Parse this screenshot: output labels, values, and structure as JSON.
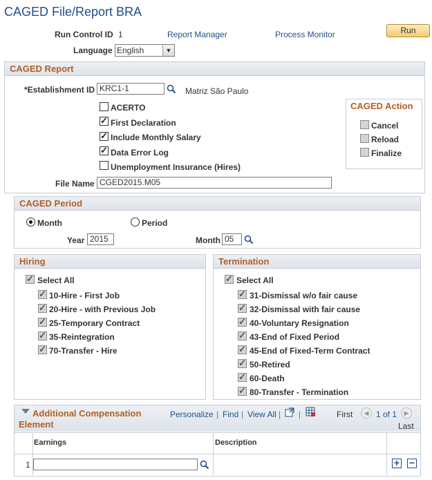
{
  "page": {
    "title": "CAGED File/Report BRA"
  },
  "header": {
    "run_control_label": "Run Control ID",
    "run_control_value": "1",
    "report_manager": "Report Manager",
    "process_monitor": "Process Monitor",
    "run_button": "Run",
    "language_label": "Language",
    "language_value": "English"
  },
  "report": {
    "title": "CAGED Report",
    "establishment_label": "*Establishment ID",
    "establishment_value": "KRC1-1",
    "establishment_desc": "Matriz São Paulo",
    "options": [
      {
        "label": "ACERTO",
        "checked": false
      },
      {
        "label": "First Declaration",
        "checked": true
      },
      {
        "label": "Include Monthly Salary",
        "checked": true
      },
      {
        "label": "Data Error Log",
        "checked": true
      },
      {
        "label": "Unemployment Insurance (Hires)",
        "checked": false
      }
    ],
    "file_name_label": "File Name",
    "file_name_value": "CGED2015.M05"
  },
  "action": {
    "title": "CAGED Action",
    "items": [
      {
        "label": "Cancel",
        "checked": false
      },
      {
        "label": "Reload",
        "checked": false
      },
      {
        "label": "Finalize",
        "checked": false
      }
    ]
  },
  "period": {
    "title": "CAGED Period",
    "month_radio": "Month",
    "period_radio": "Period",
    "selected": "Month",
    "year_label": "Year",
    "year_value": "2015",
    "month_label": "Month",
    "month_value": "05"
  },
  "hiring": {
    "title": "Hiring",
    "select_all": "Select All",
    "items": [
      "10-Hire - First Job",
      "20-Hire - with Previous Job",
      "25-Temporary Contract",
      "35-Reintegration",
      "70-Transfer - Hire"
    ]
  },
  "termination": {
    "title": "Termination",
    "select_all": "Select All",
    "items": [
      "31-Dismissal w/o fair cause",
      "32-Dismissal with fair cause",
      "40-Voluntary Resignation",
      "43-End of Fixed Period",
      "45-End of Fixed-Term Contract",
      "50-Retired",
      "60-Death",
      "80-Transfer - Termination"
    ]
  },
  "compensation": {
    "title_line1": "Additional Compensation",
    "title_line2": "Element",
    "personalize": "Personalize",
    "find": "Find",
    "view_all": "View All",
    "first": "First",
    "range": "1 of 1",
    "last": "Last",
    "col_earnings": "Earnings",
    "col_description": "Description",
    "row_number": "1",
    "earnings_value": "",
    "sep": "|"
  },
  "colors": {
    "accent": "#b45d24",
    "link": "#1f4e8c",
    "header_bg": "#dde3ea",
    "button": "#f4c96f"
  }
}
